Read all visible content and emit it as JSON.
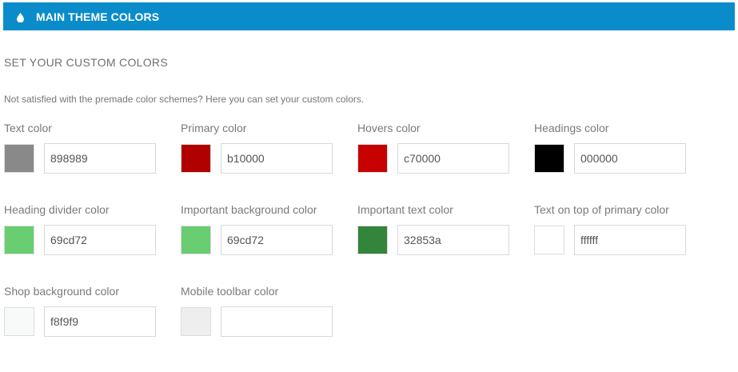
{
  "header": {
    "icon": "drop-icon",
    "title": "MAIN THEME COLORS",
    "background": "#0a8ccb"
  },
  "section": {
    "title": "SET YOUR CUSTOM COLORS",
    "description": "Not satisfied with the premade color schemes? Here you can set your custom colors."
  },
  "fields": [
    {
      "label": "Text color",
      "value": "898989",
      "swatch": "#898989"
    },
    {
      "label": "Primary color",
      "value": "b10000",
      "swatch": "#b10000"
    },
    {
      "label": "Hovers color",
      "value": "c70000",
      "swatch": "#c70000"
    },
    {
      "label": "Headings color",
      "value": "000000",
      "swatch": "#000000"
    },
    {
      "label": "Heading divider color",
      "value": "69cd72",
      "swatch": "#69cd72"
    },
    {
      "label": "Important background color",
      "value": "69cd72",
      "swatch": "#69cd72"
    },
    {
      "label": "Important text color",
      "value": "32853a",
      "swatch": "#32853a"
    },
    {
      "label": "Text on top of primary color",
      "value": "ffffff",
      "swatch": "#ffffff"
    },
    {
      "label": "Shop background color",
      "value": "f8f9f9",
      "swatch": "#f8f9f9"
    },
    {
      "label": "Mobile toolbar color",
      "value": "",
      "swatch": "#eeeeee"
    }
  ]
}
